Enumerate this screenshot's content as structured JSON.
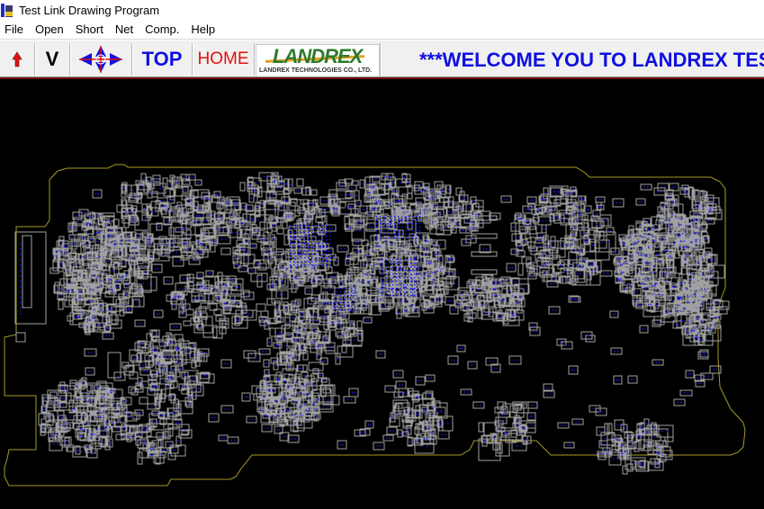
{
  "window": {
    "title": "Test Link Drawing Program",
    "icon": "app-icon"
  },
  "menu": {
    "items": [
      "File",
      "Open",
      "Short",
      "Net",
      "Comp.",
      "Help"
    ]
  },
  "toolbar": {
    "up_icon": "red-up-arrow-icon",
    "v_label": "V",
    "pan_icon": "four-way-arrow-icon",
    "top_label": "TOP",
    "home_label": "HOME",
    "logo_text": "LANDREX",
    "logo_subtext": "LANDREX TECHNOLOGIES CO., LTD.",
    "welcome_text": "***WELCOME YOU TO LANDREX TES"
  },
  "colors": {
    "outline": "#a89a2a",
    "component": "#a0a0a0",
    "pad": "#1a1aff",
    "top_label": "#1010e0",
    "home_label": "#e01010",
    "up_arrow": "#e01010",
    "background": "#000000"
  },
  "board_view": {
    "side": "TOP"
  }
}
